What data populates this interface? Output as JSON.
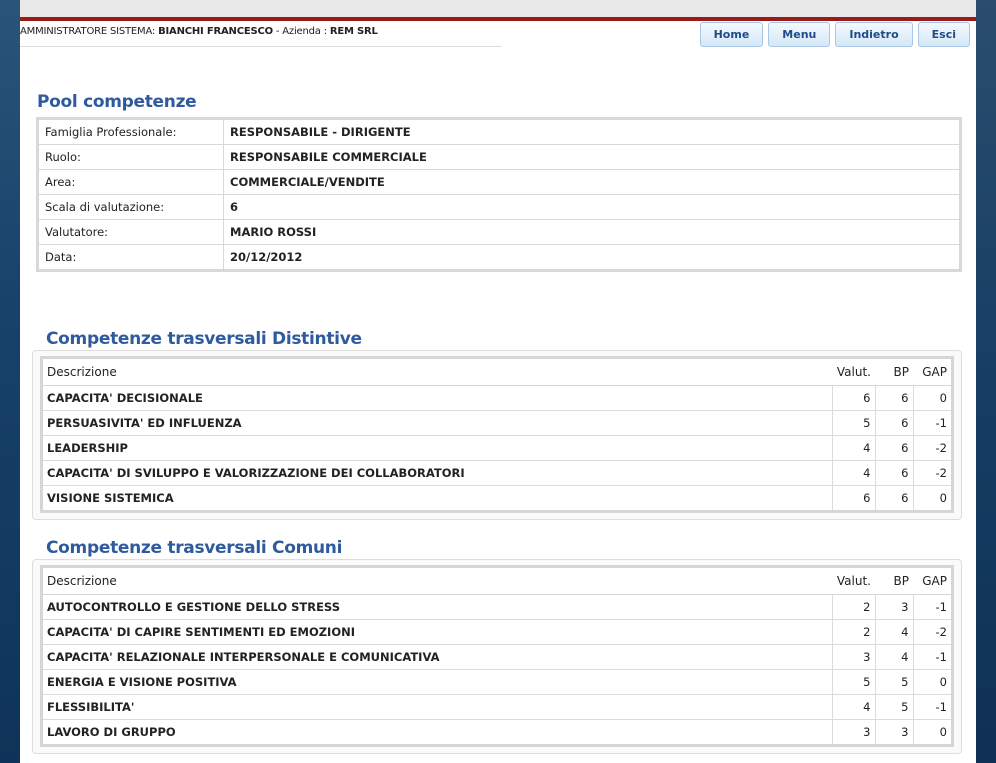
{
  "header": {
    "role": "AMMINISTRATORE SISTEMA:",
    "user": "BIANCHI FRANCESCO",
    "company_label": "- Azienda :",
    "company": "REM SRL"
  },
  "nav": [
    {
      "label": "Home"
    },
    {
      "label": "Menu"
    },
    {
      "label": "Indietro"
    },
    {
      "label": "Esci"
    }
  ],
  "pool": {
    "title": "Pool competenze",
    "rows": [
      {
        "label": "Famiglia Professionale:",
        "value": "RESPONSABILE - DIRIGENTE"
      },
      {
        "label": "Ruolo:",
        "value": "RESPONSABILE COMMERCIALE"
      },
      {
        "label": "Area:",
        "value": "COMMERCIALE/VENDITE"
      },
      {
        "label": "Scala di valutazione:",
        "value": "6"
      },
      {
        "label": "Valutatore:",
        "value": "MARIO ROSSI"
      },
      {
        "label": "Data:",
        "value": "20/12/2012"
      }
    ]
  },
  "distintive": {
    "title": "Competenze trasversali Distintive",
    "columns": {
      "desc": "Descrizione",
      "valut": "Valut.",
      "bp": "BP",
      "gap": "GAP"
    },
    "rows": [
      {
        "desc": "CAPACITA' DECISIONALE",
        "valut": "6",
        "bp": "6",
        "gap": "0"
      },
      {
        "desc": "PERSUASIVITA' ED INFLUENZA",
        "valut": "5",
        "bp": "6",
        "gap": "-1"
      },
      {
        "desc": "LEADERSHIP",
        "valut": "4",
        "bp": "6",
        "gap": "-2"
      },
      {
        "desc": "CAPACITA' DI SVILUPPO E VALORIZZAZIONE DEI COLLABORATORI",
        "valut": "4",
        "bp": "6",
        "gap": "-2"
      },
      {
        "desc": "VISIONE SISTEMICA",
        "valut": "6",
        "bp": "6",
        "gap": "0"
      }
    ]
  },
  "comuni": {
    "title": "Competenze trasversali Comuni",
    "columns": {
      "desc": "Descrizione",
      "valut": "Valut.",
      "bp": "BP",
      "gap": "GAP"
    },
    "rows": [
      {
        "desc": "AUTOCONTROLLO E GESTIONE DELLO STRESS",
        "valut": "2",
        "bp": "3",
        "gap": "-1"
      },
      {
        "desc": "CAPACITA' DI CAPIRE SENTIMENTI ED EMOZIONI",
        "valut": "2",
        "bp": "4",
        "gap": "-2"
      },
      {
        "desc": "CAPACITA' RELAZIONALE INTERPERSONALE E COMUNICATIVA",
        "valut": "3",
        "bp": "4",
        "gap": "-1"
      },
      {
        "desc": "ENERGIA E VISIONE POSITIVA",
        "valut": "5",
        "bp": "5",
        "gap": "0"
      },
      {
        "desc": "FLESSIBILITA'",
        "valut": "4",
        "bp": "5",
        "gap": "-1"
      },
      {
        "desc": "LAVORO DI GRUPPO",
        "valut": "3",
        "bp": "3",
        "gap": "0"
      }
    ]
  },
  "colors": {
    "title": "#2f5b9e",
    "accent_bar": "#9b1a1a",
    "button_text": "#1d4c86"
  }
}
